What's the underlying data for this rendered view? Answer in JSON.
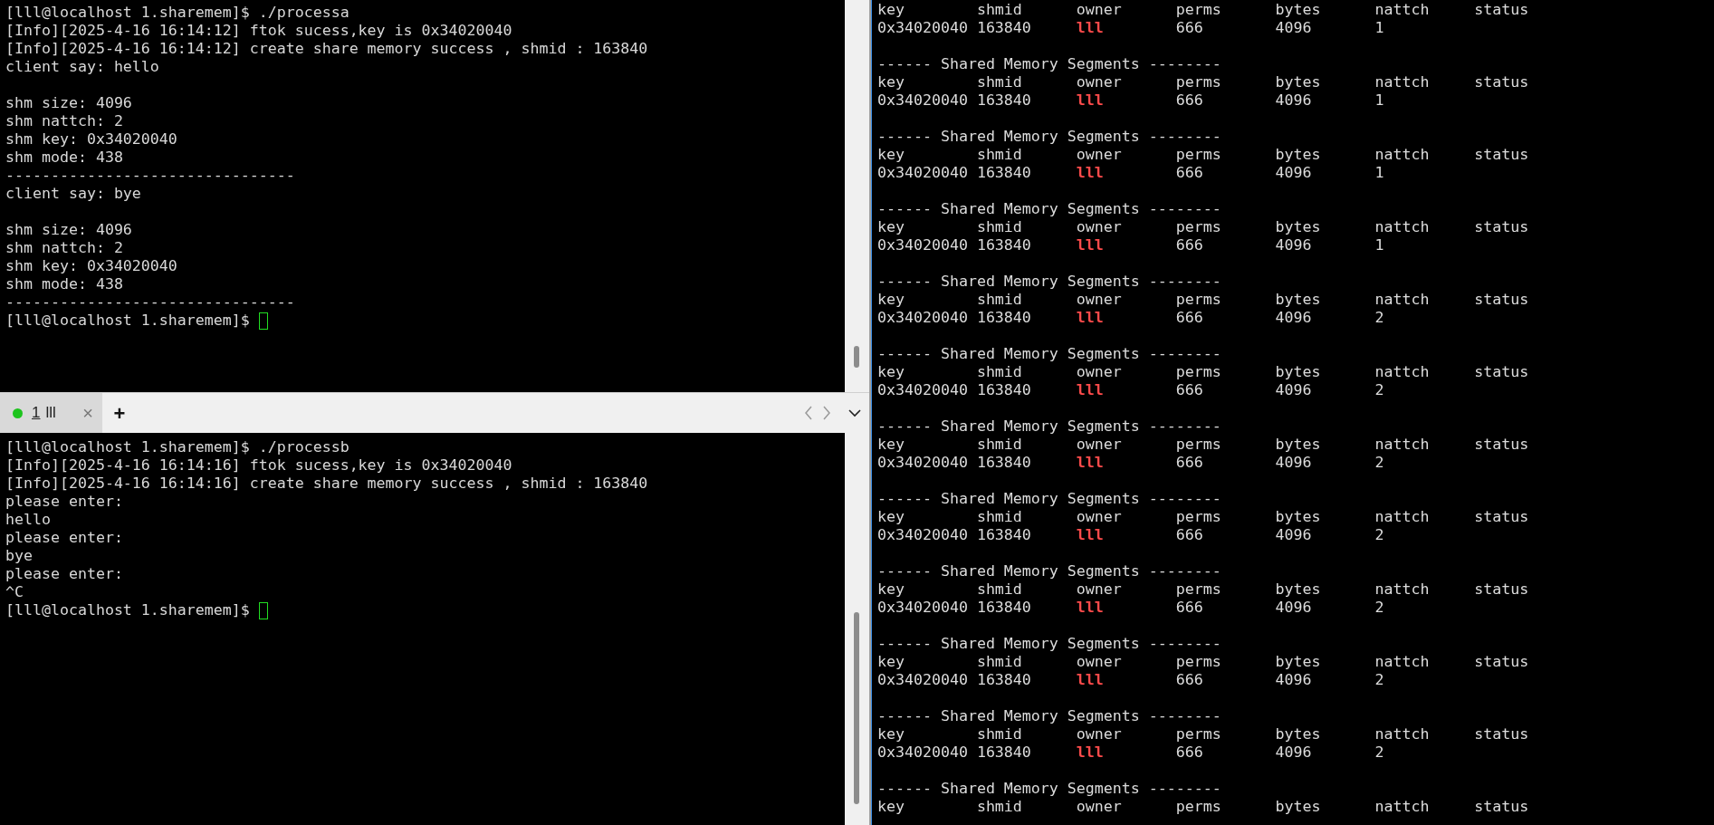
{
  "top_terminal": {
    "lines": [
      {
        "text": "[lll@localhost 1.sharemem]$ ./processa"
      },
      {
        "text": "[Info][2025-4-16 16:14:12] ftok sucess,key is 0x34020040"
      },
      {
        "text": "[Info][2025-4-16 16:14:12] create share memory success , shmid : 163840"
      },
      {
        "text": "client say: hello",
        "blank_after": true
      },
      {
        "text": "shm size: 4096"
      },
      {
        "text": "shm nattch: 2"
      },
      {
        "text": "shm key: 0x34020040"
      },
      {
        "text": "shm mode: 438"
      },
      {
        "text": "--------------------------------"
      },
      {
        "text": "client say: bye",
        "blank_after": true
      },
      {
        "text": "shm size: 4096"
      },
      {
        "text": "shm nattch: 2"
      },
      {
        "text": "shm key: 0x34020040"
      },
      {
        "text": "shm mode: 438"
      },
      {
        "text": "--------------------------------"
      },
      {
        "text": "[lll@localhost 1.sharemem]$ ",
        "cursor": true
      }
    ]
  },
  "tab_bar": {
    "tabs": [
      {
        "number": "1",
        "label": "lll",
        "selected": true,
        "active": true,
        "close": "×"
      }
    ],
    "new_tab": "+"
  },
  "bottom_terminal": {
    "lines": [
      {
        "text": "[lll@localhost 1.sharemem]$ ./processb"
      },
      {
        "text": "[Info][2025-4-16 16:14:16] ftok sucess,key is 0x34020040"
      },
      {
        "text": "[Info][2025-4-16 16:14:16] create share memory success , shmid : 163840"
      },
      {
        "text": "please enter:"
      },
      {
        "text": "hello"
      },
      {
        "text": "please enter:"
      },
      {
        "text": "bye"
      },
      {
        "text": "please enter:"
      },
      {
        "text": "^C"
      },
      {
        "text": "[lll@localhost 1.sharemem]$ ",
        "cursor": true
      }
    ]
  },
  "right_terminal": {
    "blocks": [
      {
        "columns": [
          "key",
          "shmid",
          "owner",
          "perms",
          "bytes",
          "nattch",
          "status"
        ],
        "row": [
          {
            "text": "0x34020040"
          },
          {
            "text": "163840"
          },
          {
            "text": "lll",
            "color": "#ff4b4b"
          },
          {
            "text": "666"
          },
          {
            "text": "4096"
          },
          {
            "text": "1"
          }
        ]
      },
      {
        "header": "------ Shared Memory Segments --------",
        "columns": [
          "key",
          "shmid",
          "owner",
          "perms",
          "bytes",
          "nattch",
          "status"
        ],
        "row": [
          {
            "text": "0x34020040"
          },
          {
            "text": "163840"
          },
          {
            "text": "lll",
            "color": "#ff4b4b"
          },
          {
            "text": "666"
          },
          {
            "text": "4096"
          },
          {
            "text": "1"
          }
        ]
      },
      {
        "header": "------ Shared Memory Segments --------",
        "columns": [
          "key",
          "shmid",
          "owner",
          "perms",
          "bytes",
          "nattch",
          "status"
        ],
        "row": [
          {
            "text": "0x34020040"
          },
          {
            "text": "163840"
          },
          {
            "text": "lll",
            "color": "#ff4b4b"
          },
          {
            "text": "666"
          },
          {
            "text": "4096"
          },
          {
            "text": "1"
          }
        ]
      },
      {
        "header": "------ Shared Memory Segments --------",
        "columns": [
          "key",
          "shmid",
          "owner",
          "perms",
          "bytes",
          "nattch",
          "status"
        ],
        "row": [
          {
            "text": "0x34020040"
          },
          {
            "text": "163840"
          },
          {
            "text": "lll",
            "color": "#ff4b4b"
          },
          {
            "text": "666"
          },
          {
            "text": "4096"
          },
          {
            "text": "1"
          }
        ]
      },
      {
        "header": "------ Shared Memory Segments --------",
        "columns": [
          "key",
          "shmid",
          "owner",
          "perms",
          "bytes",
          "nattch",
          "status"
        ],
        "row": [
          {
            "text": "0x34020040"
          },
          {
            "text": "163840"
          },
          {
            "text": "lll",
            "color": "#ff4b4b"
          },
          {
            "text": "666"
          },
          {
            "text": "4096"
          },
          {
            "text": "2"
          }
        ]
      },
      {
        "header": "------ Shared Memory Segments --------",
        "columns": [
          "key",
          "shmid",
          "owner",
          "perms",
          "bytes",
          "nattch",
          "status"
        ],
        "row": [
          {
            "text": "0x34020040"
          },
          {
            "text": "163840"
          },
          {
            "text": "lll",
            "color": "#ff4b4b"
          },
          {
            "text": "666"
          },
          {
            "text": "4096"
          },
          {
            "text": "2"
          }
        ]
      },
      {
        "header": "------ Shared Memory Segments --------",
        "columns": [
          "key",
          "shmid",
          "owner",
          "perms",
          "bytes",
          "nattch",
          "status"
        ],
        "row": [
          {
            "text": "0x34020040"
          },
          {
            "text": "163840"
          },
          {
            "text": "lll",
            "color": "#ff4b4b"
          },
          {
            "text": "666"
          },
          {
            "text": "4096"
          },
          {
            "text": "2"
          }
        ]
      },
      {
        "header": "------ Shared Memory Segments --------",
        "columns": [
          "key",
          "shmid",
          "owner",
          "perms",
          "bytes",
          "nattch",
          "status"
        ],
        "row": [
          {
            "text": "0x34020040"
          },
          {
            "text": "163840"
          },
          {
            "text": "lll",
            "color": "#ff4b4b"
          },
          {
            "text": "666"
          },
          {
            "text": "4096"
          },
          {
            "text": "2"
          }
        ]
      },
      {
        "header": "------ Shared Memory Segments --------",
        "columns": [
          "key",
          "shmid",
          "owner",
          "perms",
          "bytes",
          "nattch",
          "status"
        ],
        "row": [
          {
            "text": "0x34020040"
          },
          {
            "text": "163840"
          },
          {
            "text": "lll",
            "color": "#ff4b4b"
          },
          {
            "text": "666"
          },
          {
            "text": "4096"
          },
          {
            "text": "2"
          }
        ]
      },
      {
        "header": "------ Shared Memory Segments --------",
        "columns": [
          "key",
          "shmid",
          "owner",
          "perms",
          "bytes",
          "nattch",
          "status"
        ],
        "row": [
          {
            "text": "0x34020040"
          },
          {
            "text": "163840"
          },
          {
            "text": "lll",
            "color": "#ff4b4b"
          },
          {
            "text": "666"
          },
          {
            "text": "4096"
          },
          {
            "text": "2"
          }
        ]
      },
      {
        "header": "------ Shared Memory Segments --------",
        "columns": [
          "key",
          "shmid",
          "owner",
          "perms",
          "bytes",
          "nattch",
          "status"
        ],
        "row": [
          {
            "text": "0x34020040"
          },
          {
            "text": "163840"
          },
          {
            "text": "lll",
            "color": "#ff4b4b"
          },
          {
            "text": "666"
          },
          {
            "text": "4096"
          },
          {
            "text": "2"
          }
        ]
      },
      {
        "header": "------ Shared Memory Segments --------",
        "columns": [
          "key",
          "shmid",
          "owner",
          "perms",
          "bytes",
          "nattch",
          "status"
        ]
      }
    ]
  }
}
